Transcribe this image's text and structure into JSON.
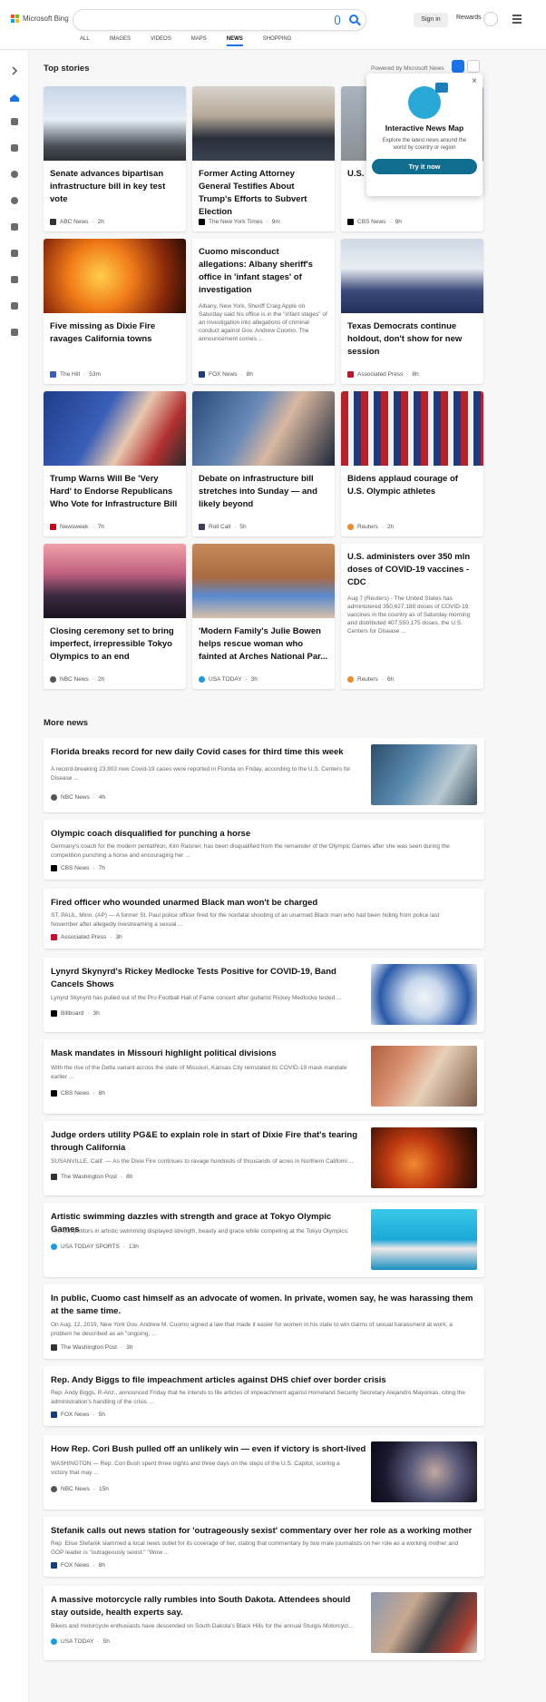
{
  "header": {
    "logo_text": "Microsoft Bing",
    "search_placeholder": "",
    "signin_label": "Sign in",
    "rewards_label": "Rewards",
    "tabs": [
      {
        "label": "ALL"
      },
      {
        "label": "IMAGES"
      },
      {
        "label": "VIDEOS"
      },
      {
        "label": "MAPS"
      },
      {
        "label": "NEWS",
        "active": true
      },
      {
        "label": "SHOPPING"
      }
    ]
  },
  "top_stories": {
    "title": "Top stories",
    "powered_by": "Powered by Microsoft News",
    "promo": {
      "title": "Interactive News Map",
      "description": "Explore the latest news around the world by country or region",
      "button_label": "Try it now",
      "close_glyph": "×"
    },
    "cards": [
      {
        "title": "Senate advances bipartisan infrastructure bill in key test vote",
        "source": "ABC News",
        "time": "2h"
      },
      {
        "title": "Former Acting Attorney General Testifies About Trump's Efforts to Subvert Election",
        "source": "The New York Times",
        "time": "9m"
      },
      {
        "title": "U.S. … Afgh… imm…",
        "source": "CBS News",
        "time": "9h"
      },
      {
        "title": "Five missing as Dixie Fire ravages California towns",
        "source": "The Hill",
        "time": "53m"
      },
      {
        "title": "Cuomo misconduct allegations: Albany sheriff's office in 'infant stages' of investigation",
        "summary": "Albany, New York, Sheriff Craig Apple on Saturday said his office is in the \"infant stages\" of an investigation into allegations of criminal conduct against Gov. Andrew Cuomo. The announcement comes ...",
        "source": "FOX News",
        "time": "8h"
      },
      {
        "title": "Texas Democrats continue holdout, don't show for new session",
        "source": "Associated Press",
        "time": "8h"
      },
      {
        "title": "Trump Warns Will Be 'Very Hard' to Endorse Republicans Who Vote for Infrastructure Bill",
        "source": "Newsweek",
        "time": "7h"
      },
      {
        "title": "Debate on infrastructure bill stretches into Sunday — and likely beyond",
        "source": "Roll Call",
        "time": "5h"
      },
      {
        "title": "Bidens applaud courage of U.S. Olympic athletes",
        "source": "Reuters",
        "time": "2h"
      },
      {
        "title": "Closing ceremony set to bring imperfect, irrepressible Tokyo Olympics to an end",
        "source": "NBC News",
        "time": "2h"
      },
      {
        "title": "'Modern Family's Julie Bowen helps rescue woman who fainted at Arches National Par...",
        "source": "USA TODAY",
        "time": "3h"
      },
      {
        "title": "U.S. administers over 350 mln doses of COVID-19 vaccines - CDC",
        "summary": "Aug 7 (Reuters) - The United States has administered 350,627,188 doses of COVID-19 vaccines in the country as of Saturday morning and distributed 407,550,175 doses, the U.S. Centers for Disease ...",
        "source": "Reuters",
        "time": "6h"
      }
    ]
  },
  "more_news": {
    "title": "More news",
    "items": [
      {
        "title": "Florida breaks record for new daily Covid cases for third time this week",
        "summary": "A record-breaking 23,903 new Covid-19 cases were reported in Florida on Friday, according to the U.S. Centers for Disease ...",
        "source": "NBC News",
        "time": "4h"
      },
      {
        "title": "Olympic coach disqualified for punching a horse",
        "summary": "Germany's coach for the modern pentathlon, Kim Raisner, has been disqualified from the remainder of the Olympic Games after she was seen during the competition punching a horse and encouraging her ...",
        "source": "CBS News",
        "time": "7h"
      },
      {
        "title": "Fired officer who wounded unarmed Black man won't be charged",
        "summary": "ST. PAUL, Minn. (AP) — A former St. Paul police officer fired for the nonfatal shooting of an unarmed Black man who had been hiding from police last November after allegedly livestreaming a sexual ...",
        "source": "Associated Press",
        "time": "3h"
      },
      {
        "title": "Lynyrd Skynyrd's Rickey Medlocke Tests Positive for COVID-19, Band Cancels Shows",
        "summary": "Lynyrd Skynyrd has pulled out of the Pro Football Hall of Fame concert after guitarist Rickey Medlocke tested ...",
        "source": "Billboard",
        "time": "3h"
      },
      {
        "title": "Mask mandates in Missouri highlight political divisions",
        "summary": "With the rise of the Delta variant across the state of Missouri, Kansas City reinstated its COVID-19 mask mandate earlier ...",
        "source": "CBS News",
        "time": "8h"
      },
      {
        "title": "Judge orders utility PG&E to explain role in start of Dixie Fire that's tearing through California",
        "summary": "SUSANVILLE, Calif. — As the Dixie Fire continues to ravage hundreds of thousands of acres in Northern California, a ...",
        "source": "The Washington Post",
        "time": "8h"
      },
      {
        "title": "Artistic swimming dazzles with strength and grace at Tokyo Olympic Games",
        "summary": "The competitors in artistic swimming displayed strength, beauty and grace while competing at the Tokyo Olympics.",
        "source": "USA TODAY SPORTS",
        "time": "13h"
      },
      {
        "title": "In public, Cuomo cast himself as an advocate of women. In private, women say, he was harassing them at the same time.",
        "summary": "On Aug. 12, 2019, New York Gov. Andrew M. Cuomo signed a law that made it easier for women in his state to win claims of sexual harassment at work, a problem he described as an \"ongoing, ...",
        "source": "The Washington Post",
        "time": "3h"
      },
      {
        "title": "Rep. Andy Biggs to file impeachment articles against DHS chief over border crisis",
        "summary": "Rep. Andy Biggs, R-Ariz., announced Friday that he intends to file articles of impeachment against Homeland Security Secretary Alejandro Mayorkas, citing the administration's handling of the crisis ...",
        "source": "FOX News",
        "time": "5h"
      },
      {
        "title": "How Rep. Cori Bush pulled off an unlikely win — even if victory is short-lived",
        "summary": "WASHINGTON — Rep. Cori Bush spent three nights and three days on the steps of the U.S. Capitol, scoring a victory that may ...",
        "source": "NBC News",
        "time": "15h"
      },
      {
        "title": "Stefanik calls out news station for 'outrageously sexist' commentary over her role as a working mother",
        "summary": "Rep. Elise Stefanik slammed a local news outlet for its coverage of her, stating that commentary by two male journalists on her role as a working mother and GOP leader is \"outrageously sexist.\" \"Wow ...",
        "source": "FOX News",
        "time": "8h"
      },
      {
        "title": "A massive motorcycle rally rumbles into South Dakota. Attendees should stay outside, health experts say.",
        "summary": "Bikers and motorcycle enthusiasts have descended on South Dakota's Black Hills for the annual Sturgis Motorcycle ...",
        "source": "USA TODAY",
        "time": "5h"
      }
    ]
  },
  "icons": {
    "rail": [
      "collapse-icon",
      "home-icon",
      "sports-icon",
      "flag-icon",
      "location-icon",
      "world-icon",
      "chart-icon",
      "science-icon",
      "entertainment-icon",
      "money-icon",
      "lifestyle-icon"
    ]
  },
  "colors": {
    "accent": "#1a73e8",
    "promo_button": "#0f6e8f"
  }
}
